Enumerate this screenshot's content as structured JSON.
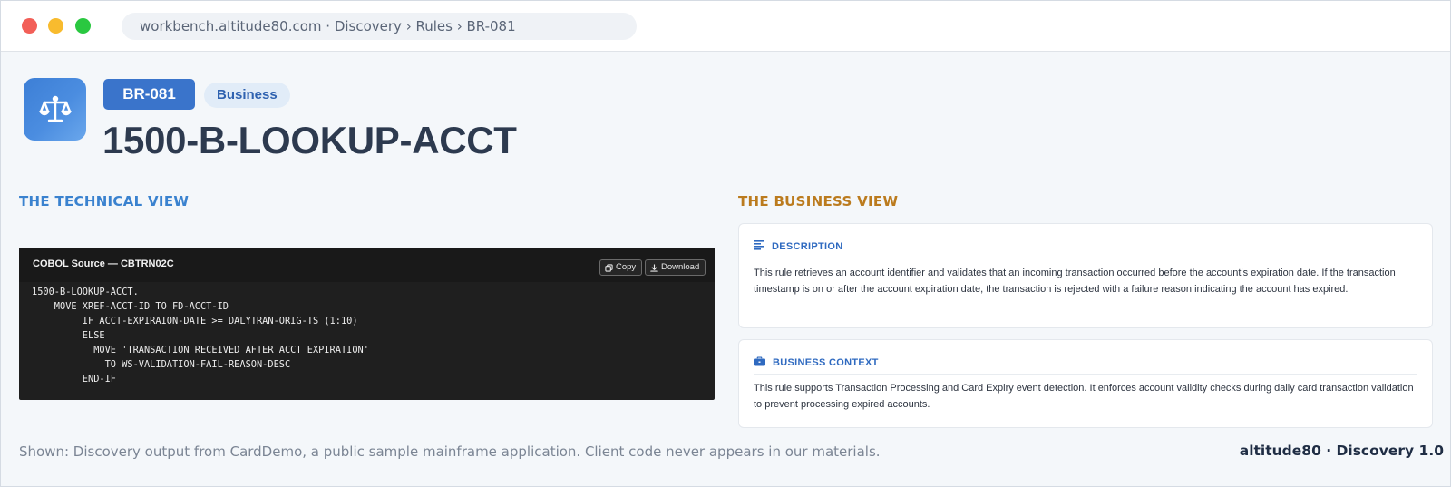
{
  "window": {
    "address": "workbench.altitude80.com  ·  Discovery › Rules › BR-081"
  },
  "header": {
    "icon": "balance-scale-icon",
    "rule_id": "BR-081",
    "rule_type": "Business",
    "title": "1500-B-LOOKUP-ACCT"
  },
  "technical_view": {
    "heading": "THE TECHNICAL VIEW",
    "code_title": "COBOL Source — CBTRN02C",
    "copy_label": "Copy",
    "download_label": "Download",
    "code": "1500-B-LOOKUP-ACCT.\n    MOVE XREF-ACCT-ID TO FD-ACCT-ID\n         IF ACCT-EXPIRAION-DATE >= DALYTRAN-ORIG-TS (1:10)\n         ELSE\n           MOVE 'TRANSACTION RECEIVED AFTER ACCT EXPIRATION'\n             TO WS-VALIDATION-FAIL-REASON-DESC\n         END-IF"
  },
  "business_view": {
    "heading": "THE BUSINESS VIEW",
    "description": {
      "label": "DESCRIPTION",
      "icon": "align-left-icon",
      "text": "This rule retrieves an account identifier and validates that an incoming transaction occurred before the account's expiration date. If the transaction timestamp is on or after the account expiration date, the transaction is rejected with a failure reason indicating the account has expired."
    },
    "context": {
      "label": "BUSINESS CONTEXT",
      "icon": "briefcase-icon",
      "text": "This rule supports Transaction Processing and Card Expiry event detection. It enforces account validity checks during daily card transaction validation to prevent processing expired accounts."
    }
  },
  "footer": {
    "note": "Shown: Discovery output from CardDemo, a public sample mainframe application. Client code never appears in our materials.",
    "brand": "altitude80 · Discovery 1.0"
  },
  "colors": {
    "accent_blue": "#3a74cb",
    "technical_heading": "#3a82cf",
    "business_heading": "#bb7b1e",
    "code_background": "#1f1f1f",
    "page_background": "#f4f7fa"
  }
}
